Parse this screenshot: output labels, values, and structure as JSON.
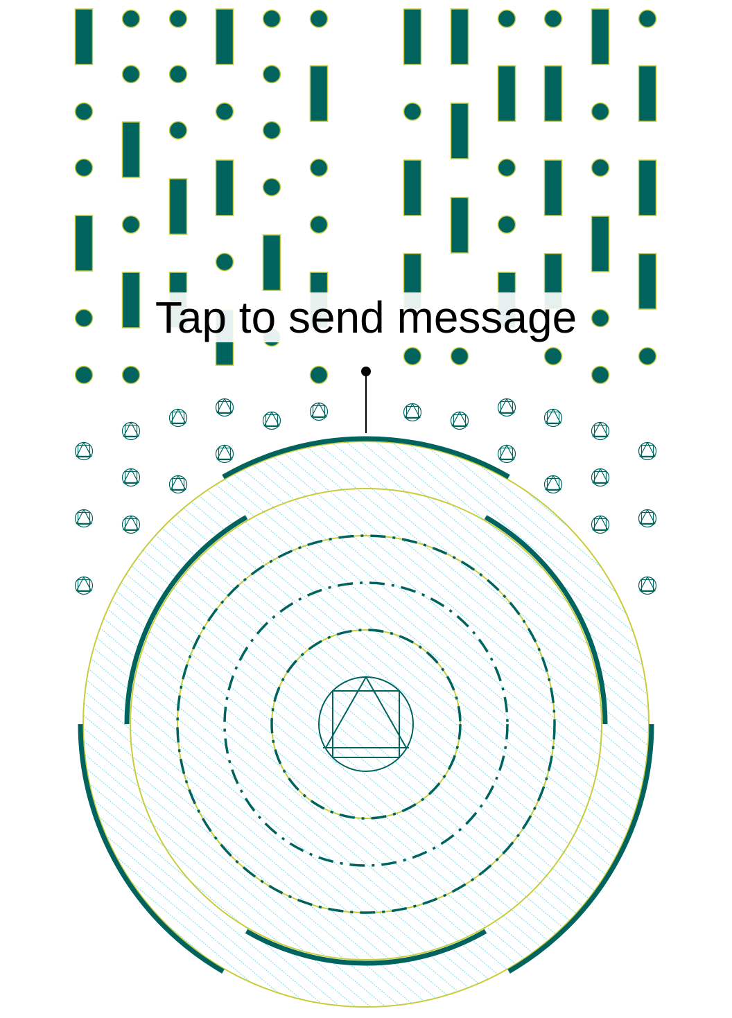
{
  "callout": {
    "label": "Tap to send message"
  },
  "colors": {
    "teal": "#00635E",
    "olive": "#C8CC3A",
    "hatch": "#7FDDF0",
    "background": "#FFFFFF",
    "text": "#000000"
  }
}
